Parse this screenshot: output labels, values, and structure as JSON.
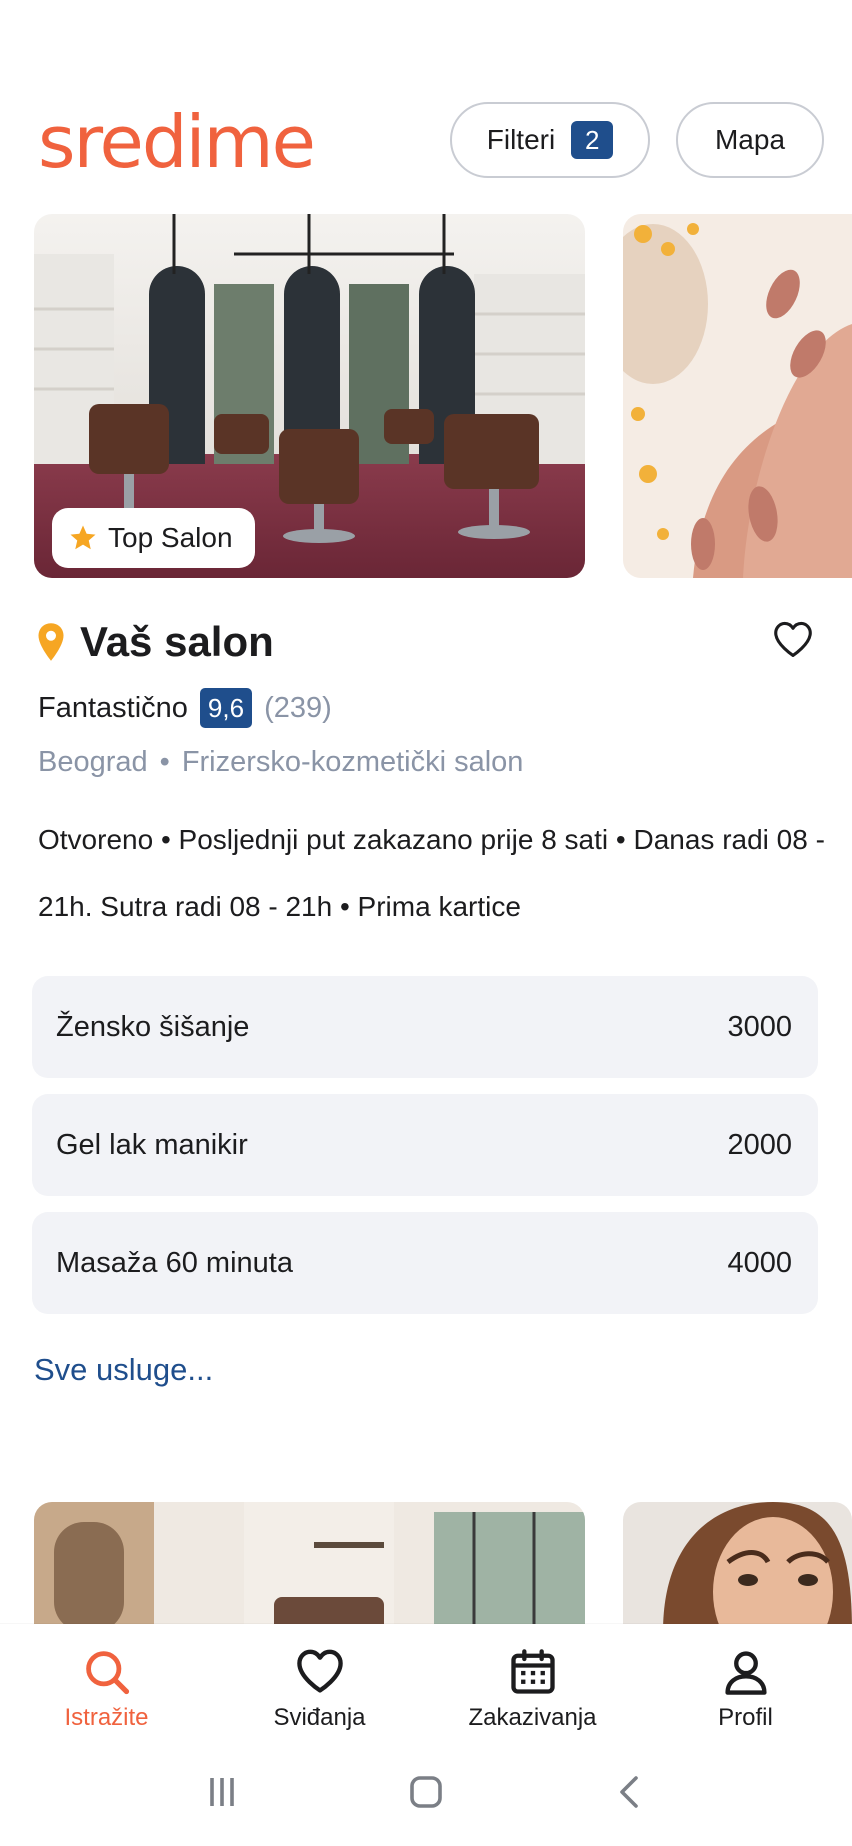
{
  "app": {
    "logo_text": "sredime",
    "brand_color": "#f0623e",
    "accent_color": "#1f4e8c"
  },
  "header": {
    "filters_label": "Filteri",
    "filters_count": "2",
    "map_label": "Mapa"
  },
  "carousel": {
    "badge_label": "Top Salon",
    "badge_icon": "star-icon"
  },
  "salon": {
    "name": "Vaš salon",
    "location_icon": "location-pin-icon",
    "rating_label": "Fantastično",
    "score": "9,6",
    "reviews": "(239)",
    "city": "Beograd",
    "separator": "•",
    "category": "Frizersko-kozmetički salon",
    "description": "Otvoreno • Posljednji put zakazano prije 8 sati • Danas radi 08 - 21h. Sutra radi 08 - 21h • Prima kartice"
  },
  "services": [
    {
      "name": "Žensko šišanje",
      "price": "3000"
    },
    {
      "name": "Gel lak manikir",
      "price": "2000"
    },
    {
      "name": "Masaža 60 minuta",
      "price": "4000"
    }
  ],
  "all_services_link": "Sve usluge...",
  "bottom_nav": [
    {
      "label": "Istražite",
      "icon": "search-icon",
      "active": true
    },
    {
      "label": "Sviđanja",
      "icon": "heart-icon",
      "active": false
    },
    {
      "label": "Zakazivanja",
      "icon": "calendar-icon",
      "active": false
    },
    {
      "label": "Profil",
      "icon": "user-icon",
      "active": false
    }
  ],
  "system_nav": [
    "recents-icon",
    "home-icon",
    "back-icon"
  ]
}
